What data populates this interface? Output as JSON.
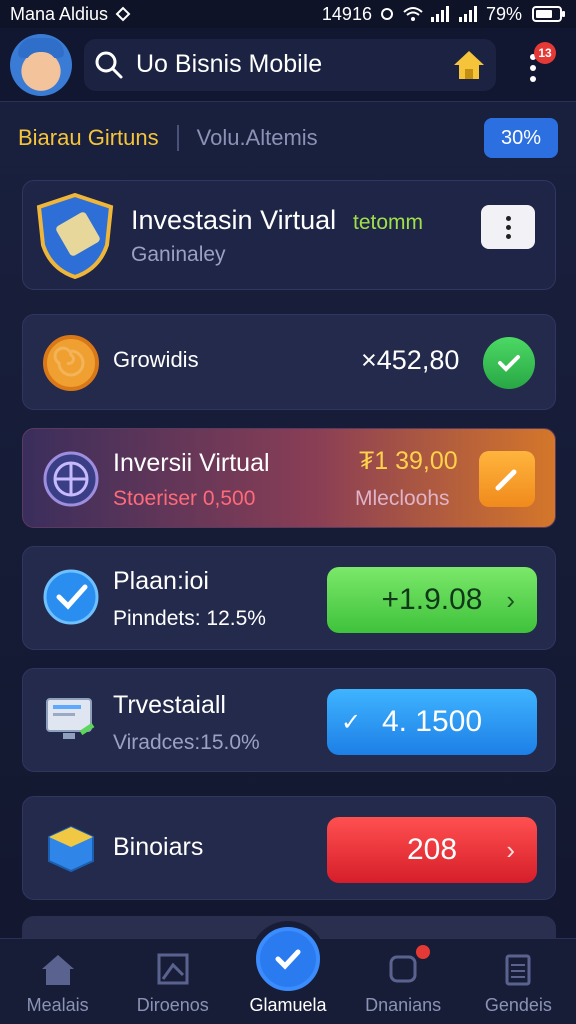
{
  "status_bar": {
    "carrier": "Mana Aldius",
    "time": "14916",
    "battery": "79%"
  },
  "header": {
    "search_value": "Uo Bisnis Mobile",
    "notification_count": "13"
  },
  "tabs": {
    "active": "Biarau Girtuns",
    "inactive": "Volu.Altemis",
    "percent": "30%"
  },
  "featured": {
    "title": "Investasin Virtual",
    "tag": "tetomm",
    "subtitle": "Ganinaley"
  },
  "rows": [
    {
      "title": "Growidis",
      "value": "×452,80",
      "icon": "spiral-coin-icon",
      "action": "check"
    },
    {
      "title": "Inversii Virtual",
      "subtitle": "Stoeriser 0,500",
      "value": "₮1 39,00",
      "value_sub": "Mlecloohs",
      "icon": "globe-icon",
      "action": "pencil"
    },
    {
      "title": "Plaan:ioi",
      "subtitle": "Pinndets: 12.5%",
      "button": "+1.9.08",
      "icon": "checkmark-icon"
    },
    {
      "title": "Trvestaiall",
      "subtitle": "Viradces:15.0%",
      "button": "4. 1500",
      "icon": "monitor-icon"
    },
    {
      "title": "Binoiars",
      "button": "208",
      "icon": "box-icon"
    }
  ],
  "bottom_nav": [
    {
      "label": "Mealais",
      "icon": "home-icon"
    },
    {
      "label": "Diroenos",
      "icon": "chart-icon"
    },
    {
      "label": "Glamuela",
      "icon": "check-circle-icon"
    },
    {
      "label": "Dnanians",
      "icon": "bell-icon"
    },
    {
      "label": "Gendeis",
      "icon": "clipboard-icon"
    }
  ],
  "colors": {
    "accent_blue": "#2b6fe0",
    "accent_gold": "#f5c43a",
    "green": "#3fc23c",
    "red": "#d61e2a"
  }
}
